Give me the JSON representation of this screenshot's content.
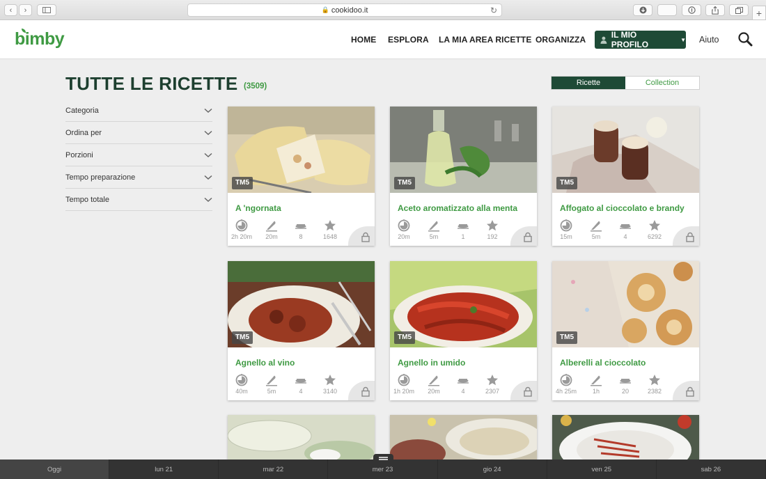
{
  "browser": {
    "url": "cookidoo.it"
  },
  "header": {
    "logo": "bimby",
    "nav": [
      "HOME",
      "ESPLORA",
      "LA MIA AREA RICETTE",
      "ORGANIZZA"
    ],
    "profile": "IL MIO PROFILO",
    "help": "Aiuto"
  },
  "page": {
    "title": "TUTTE LE RICETTE",
    "count": "(3509)",
    "tabs": [
      "Ricette",
      "Collection"
    ],
    "selected_tab": "Ricette"
  },
  "filters": [
    "Categoria",
    "Ordina per",
    "Porzioni",
    "Tempo preparazione",
    "Tempo totale"
  ],
  "badge": "TM5",
  "recipes": [
    {
      "title": "A 'ngornata",
      "total": "2h 20m",
      "prep": "20m",
      "portions": "8",
      "ratings": "1648"
    },
    {
      "title": "Aceto aromatizzato alla menta",
      "total": "20m",
      "prep": "5m",
      "portions": "1",
      "ratings": "192"
    },
    {
      "title": "Affogato al cioccolato e brandy",
      "total": "15m",
      "prep": "5m",
      "portions": "4",
      "ratings": "6292"
    },
    {
      "title": "Agnello al vino",
      "total": "40m",
      "prep": "5m",
      "portions": "4",
      "ratings": "3140"
    },
    {
      "title": "Agnello in umido",
      "total": "1h 20m",
      "prep": "20m",
      "portions": "4",
      "ratings": "2307"
    },
    {
      "title": "Alberelli al cioccolato",
      "total": "4h 25m",
      "prep": "1h",
      "portions": "20",
      "ratings": "2382"
    }
  ],
  "days": [
    "Oggi",
    "lun 21",
    "mar 22",
    "mer 23",
    "gio 24",
    "ven 25",
    "sab 26"
  ],
  "colors": {
    "brand_green": "#3f9a43",
    "dark_green": "#1e4a36"
  }
}
